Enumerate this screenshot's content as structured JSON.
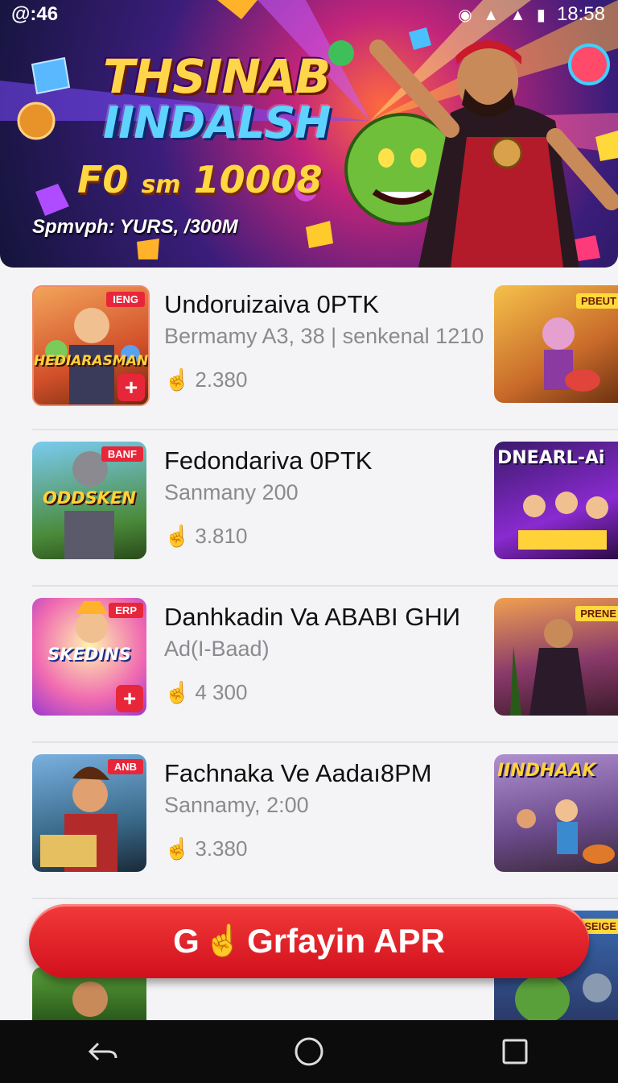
{
  "status_bar": {
    "left_text": "@:46",
    "time": "18:58"
  },
  "banner": {
    "title_line1": "THSINAB",
    "title_line2": "IINDALSH",
    "offer_prefix": "F0",
    "offer_small": "sm",
    "offer_value": "10008",
    "subtitle": "Spmvph: YURS, /300M"
  },
  "apps": [
    {
      "title": "Undoruizaiva 0PTK",
      "subtitle": "Bermamy A3, 38 | senkenal 1210",
      "stat": "2.380",
      "thumb_tag": "IENG",
      "thumb_word": "HEDIARASMAN",
      "has_plus": true,
      "side_tag": "PBEUT",
      "side_word": ""
    },
    {
      "title": "Fedondariva 0PTK",
      "subtitle": "Sanmany 200",
      "stat": "3.810",
      "thumb_tag": "BANF",
      "thumb_word": "ODDSKEN",
      "has_plus": false,
      "side_tag": "",
      "side_word": "DNEARL-Ai"
    },
    {
      "title": "Danhkadin Va ABABI GHИ",
      "subtitle": "Ad(I-Baad)",
      "stat": "4 300",
      "thumb_tag": "ERP",
      "thumb_word": "SKEDINS",
      "has_plus": true,
      "side_tag": "PRENE",
      "side_word": ""
    },
    {
      "title": "Fachnaka Ve Aadaı8PM",
      "subtitle": "Sannamy, 2:00",
      "stat": "3.380",
      "thumb_tag": "ANB",
      "thumb_word": "",
      "has_plus": false,
      "side_tag": "",
      "side_word": "IINDHAAK"
    }
  ],
  "cta": {
    "label_prefix": "G",
    "label": "Grfayin APR"
  },
  "partial_row": {
    "side_tag": "SEIGE"
  },
  "colors": {
    "accent_red": "#e8263a",
    "cta_red": "#d1101c",
    "text_primary": "#111111",
    "text_secondary": "#8a8a8f"
  },
  "icons": {
    "stat_icon": "tap-hand-icon",
    "nav": [
      "back-icon",
      "home-icon",
      "recents-icon"
    ]
  }
}
